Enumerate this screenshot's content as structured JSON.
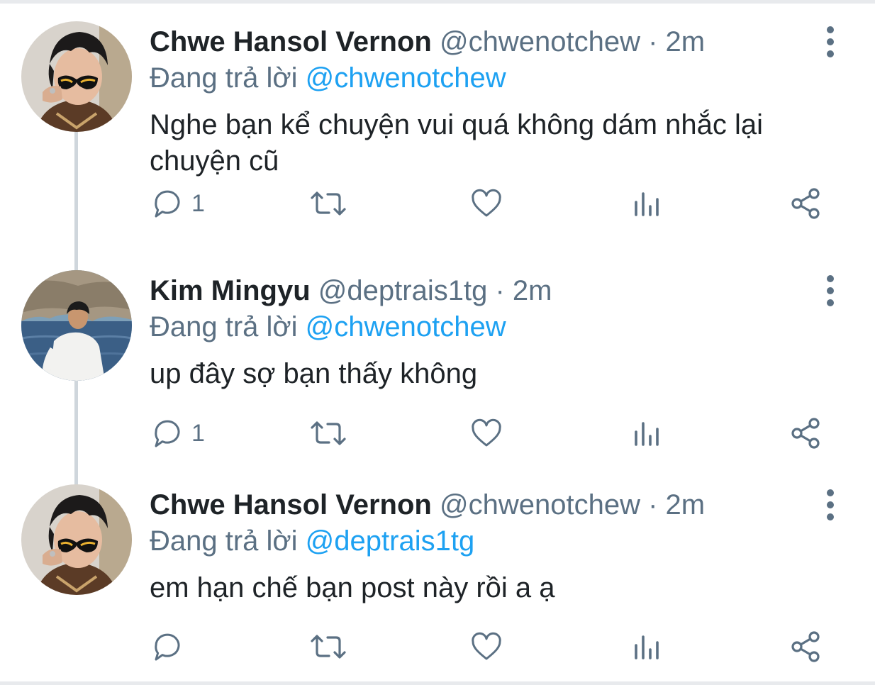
{
  "labels": {
    "replying_to": "Đang trả lời",
    "separator": "·"
  },
  "colors": {
    "name": "#1e2327",
    "secondary": "#5b7083",
    "mention": "#1da1f2",
    "thread_line": "#cfd6dc"
  },
  "tweets": [
    {
      "name": "Chwe Hansol Vernon",
      "handle": "@chwenotchew",
      "time": "2m",
      "reply_to": "@chwenotchew",
      "text": "Nghe bạn kể chuyện vui quá không dám nhắc lại chuyện cũ",
      "reply_count": "1",
      "avatar": "person-sunglasses-avatar"
    },
    {
      "name": "Kim Mingyu",
      "handle": "@deptrais1tg",
      "time": "2m",
      "reply_to": "@chwenotchew",
      "text": "up đây sợ bạn thấy không",
      "reply_count": "1",
      "avatar": "person-by-sea-avatar"
    },
    {
      "name": "Chwe Hansol Vernon",
      "handle": "@chwenotchew",
      "time": "2m",
      "reply_to": "@deptrais1tg",
      "text": "em hạn chế bạn post này rồi a ạ",
      "reply_count": "",
      "avatar": "person-sunglasses-avatar"
    }
  ],
  "icons": {
    "reply": "reply-icon",
    "retweet": "retweet-icon",
    "like": "heart-icon",
    "analytics": "analytics-icon",
    "share": "share-icon",
    "more": "more-vertical-icon"
  }
}
